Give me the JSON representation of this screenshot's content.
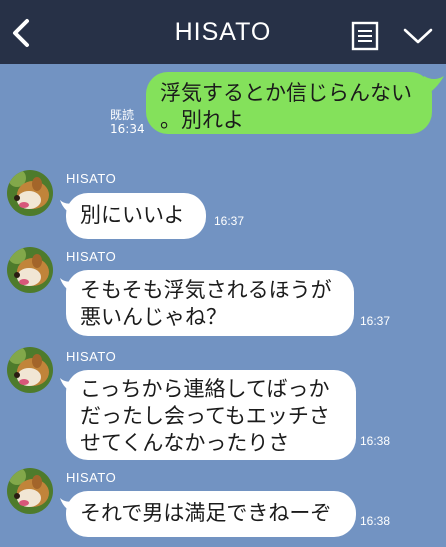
{
  "header": {
    "title": "HISATO",
    "background": "#273147"
  },
  "colors": {
    "chat_background": "#7293c2",
    "incoming_bubble": "#ffffff",
    "outgoing_bubble": "#84e15b"
  },
  "icons": {
    "back": "back-arrow-icon",
    "notes": "notes-icon",
    "menu": "chevron-down-icon",
    "avatar": "dog-avatar"
  },
  "messages": [
    {
      "direction": "outgoing",
      "lines": [
        "浮気するとか信じらんない",
        "。別れよ"
      ],
      "read_label": "既読",
      "time": "16:34"
    },
    {
      "direction": "incoming",
      "sender": "HISATO",
      "lines": [
        "別にいいよ"
      ],
      "time": "16:37"
    },
    {
      "direction": "incoming",
      "sender": "HISATO",
      "lines": [
        "そもそも浮気されるほうが",
        "悪いんじゃね？"
      ],
      "time": "16:37"
    },
    {
      "direction": "incoming",
      "sender": "HISATO",
      "lines": [
        "こっちから連絡してばっか",
        "だったし会ってもエッチさ",
        "せてくんなかったりさ"
      ],
      "time": "16:38"
    },
    {
      "direction": "incoming",
      "sender": "HISATO",
      "lines": [
        "それで男は満足できねーぞ"
      ],
      "time": "16:38"
    }
  ]
}
